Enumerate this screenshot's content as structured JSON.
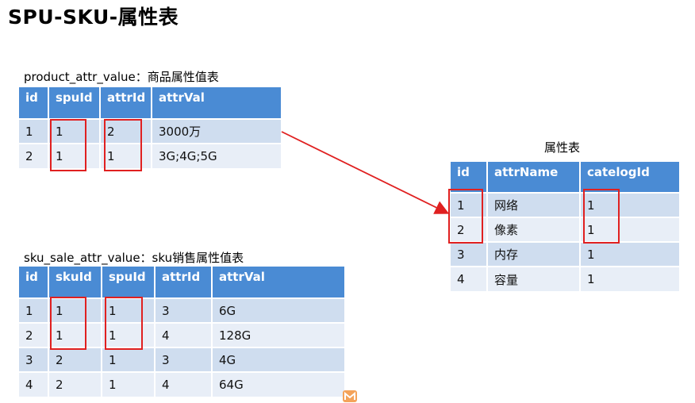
{
  "title": "SPU-SKU-属性表",
  "product_attr": {
    "caption": "product_attr_value：商品属性值表",
    "headers": [
      "id",
      "spuId",
      "attrId",
      "attrVal"
    ],
    "rows": [
      [
        "1",
        "1",
        "2",
        "3000万"
      ],
      [
        "2",
        "1",
        "1",
        "3G;4G;5G"
      ]
    ]
  },
  "sku_sale_attr": {
    "caption": "sku_sale_attr_value：sku销售属性值表",
    "headers": [
      "id",
      "skuId",
      "spuId",
      "attrId",
      "attrVal"
    ],
    "rows": [
      [
        "1",
        "1",
        "1",
        "3",
        "6G"
      ],
      [
        "2",
        "1",
        "1",
        "4",
        "128G"
      ],
      [
        "3",
        "2",
        "1",
        "3",
        "4G"
      ],
      [
        "4",
        "2",
        "1",
        "4",
        "64G"
      ]
    ]
  },
  "attr": {
    "caption": "属性表",
    "headers": [
      "id",
      "attrName",
      "catelogId"
    ],
    "rows": [
      [
        "1",
        "网络",
        "1"
      ],
      [
        "2",
        "像素",
        "1"
      ],
      [
        "3",
        "内存",
        "1"
      ],
      [
        "4",
        "容量",
        "1"
      ]
    ]
  },
  "colors": {
    "header_blue": "#4a8bd4",
    "row_odd": "#cfddef",
    "row_even": "#e8eef7",
    "highlight_red": "#e02020"
  },
  "icons": [
    "brand-logo-icon"
  ]
}
